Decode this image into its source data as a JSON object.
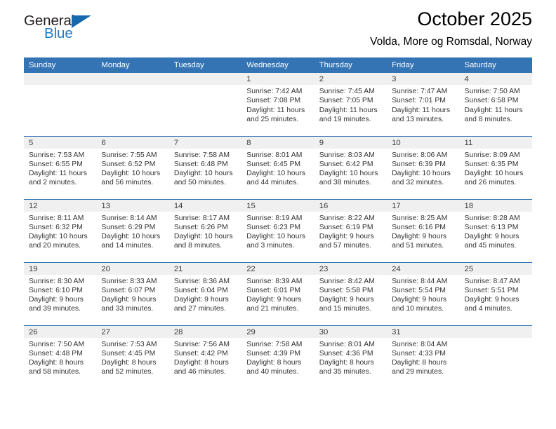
{
  "brand": {
    "name_part1": "General",
    "name_part2": "Blue",
    "triangle_icon": "triangle-icon",
    "color_dark": "#231f20",
    "color_blue": "#1f7ac4"
  },
  "header": {
    "title": "October 2025",
    "subtitle": "Volda, More og Romsdal, Norway",
    "header_bg": "#3474b4",
    "band_bg": "#f0f0f0"
  },
  "weekdays": [
    "Sunday",
    "Monday",
    "Tuesday",
    "Wednesday",
    "Thursday",
    "Friday",
    "Saturday"
  ],
  "labels": {
    "sunrise": "Sunrise:",
    "sunset": "Sunset:",
    "daylight": "Daylight:"
  },
  "weeks": [
    [
      {
        "day": "",
        "empty": true
      },
      {
        "day": "",
        "empty": true
      },
      {
        "day": "",
        "empty": true
      },
      {
        "day": "1",
        "sunrise": "Sunrise: 7:42 AM",
        "sunset": "Sunset: 7:08 PM",
        "daylight1": "Daylight: 11 hours",
        "daylight2": "and 25 minutes."
      },
      {
        "day": "2",
        "sunrise": "Sunrise: 7:45 AM",
        "sunset": "Sunset: 7:05 PM",
        "daylight1": "Daylight: 11 hours",
        "daylight2": "and 19 minutes."
      },
      {
        "day": "3",
        "sunrise": "Sunrise: 7:47 AM",
        "sunset": "Sunset: 7:01 PM",
        "daylight1": "Daylight: 11 hours",
        "daylight2": "and 13 minutes."
      },
      {
        "day": "4",
        "sunrise": "Sunrise: 7:50 AM",
        "sunset": "Sunset: 6:58 PM",
        "daylight1": "Daylight: 11 hours",
        "daylight2": "and 8 minutes."
      }
    ],
    [
      {
        "day": "5",
        "sunrise": "Sunrise: 7:53 AM",
        "sunset": "Sunset: 6:55 PM",
        "daylight1": "Daylight: 11 hours",
        "daylight2": "and 2 minutes."
      },
      {
        "day": "6",
        "sunrise": "Sunrise: 7:55 AM",
        "sunset": "Sunset: 6:52 PM",
        "daylight1": "Daylight: 10 hours",
        "daylight2": "and 56 minutes."
      },
      {
        "day": "7",
        "sunrise": "Sunrise: 7:58 AM",
        "sunset": "Sunset: 6:48 PM",
        "daylight1": "Daylight: 10 hours",
        "daylight2": "and 50 minutes."
      },
      {
        "day": "8",
        "sunrise": "Sunrise: 8:01 AM",
        "sunset": "Sunset: 6:45 PM",
        "daylight1": "Daylight: 10 hours",
        "daylight2": "and 44 minutes."
      },
      {
        "day": "9",
        "sunrise": "Sunrise: 8:03 AM",
        "sunset": "Sunset: 6:42 PM",
        "daylight1": "Daylight: 10 hours",
        "daylight2": "and 38 minutes."
      },
      {
        "day": "10",
        "sunrise": "Sunrise: 8:06 AM",
        "sunset": "Sunset: 6:39 PM",
        "daylight1": "Daylight: 10 hours",
        "daylight2": "and 32 minutes."
      },
      {
        "day": "11",
        "sunrise": "Sunrise: 8:09 AM",
        "sunset": "Sunset: 6:35 PM",
        "daylight1": "Daylight: 10 hours",
        "daylight2": "and 26 minutes."
      }
    ],
    [
      {
        "day": "12",
        "sunrise": "Sunrise: 8:11 AM",
        "sunset": "Sunset: 6:32 PM",
        "daylight1": "Daylight: 10 hours",
        "daylight2": "and 20 minutes."
      },
      {
        "day": "13",
        "sunrise": "Sunrise: 8:14 AM",
        "sunset": "Sunset: 6:29 PM",
        "daylight1": "Daylight: 10 hours",
        "daylight2": "and 14 minutes."
      },
      {
        "day": "14",
        "sunrise": "Sunrise: 8:17 AM",
        "sunset": "Sunset: 6:26 PM",
        "daylight1": "Daylight: 10 hours",
        "daylight2": "and 8 minutes."
      },
      {
        "day": "15",
        "sunrise": "Sunrise: 8:19 AM",
        "sunset": "Sunset: 6:23 PM",
        "daylight1": "Daylight: 10 hours",
        "daylight2": "and 3 minutes."
      },
      {
        "day": "16",
        "sunrise": "Sunrise: 8:22 AM",
        "sunset": "Sunset: 6:19 PM",
        "daylight1": "Daylight: 9 hours",
        "daylight2": "and 57 minutes."
      },
      {
        "day": "17",
        "sunrise": "Sunrise: 8:25 AM",
        "sunset": "Sunset: 6:16 PM",
        "daylight1": "Daylight: 9 hours",
        "daylight2": "and 51 minutes."
      },
      {
        "day": "18",
        "sunrise": "Sunrise: 8:28 AM",
        "sunset": "Sunset: 6:13 PM",
        "daylight1": "Daylight: 9 hours",
        "daylight2": "and 45 minutes."
      }
    ],
    [
      {
        "day": "19",
        "sunrise": "Sunrise: 8:30 AM",
        "sunset": "Sunset: 6:10 PM",
        "daylight1": "Daylight: 9 hours",
        "daylight2": "and 39 minutes."
      },
      {
        "day": "20",
        "sunrise": "Sunrise: 8:33 AM",
        "sunset": "Sunset: 6:07 PM",
        "daylight1": "Daylight: 9 hours",
        "daylight2": "and 33 minutes."
      },
      {
        "day": "21",
        "sunrise": "Sunrise: 8:36 AM",
        "sunset": "Sunset: 6:04 PM",
        "daylight1": "Daylight: 9 hours",
        "daylight2": "and 27 minutes."
      },
      {
        "day": "22",
        "sunrise": "Sunrise: 8:39 AM",
        "sunset": "Sunset: 6:01 PM",
        "daylight1": "Daylight: 9 hours",
        "daylight2": "and 21 minutes."
      },
      {
        "day": "23",
        "sunrise": "Sunrise: 8:42 AM",
        "sunset": "Sunset: 5:58 PM",
        "daylight1": "Daylight: 9 hours",
        "daylight2": "and 15 minutes."
      },
      {
        "day": "24",
        "sunrise": "Sunrise: 8:44 AM",
        "sunset": "Sunset: 5:54 PM",
        "daylight1": "Daylight: 9 hours",
        "daylight2": "and 10 minutes."
      },
      {
        "day": "25",
        "sunrise": "Sunrise: 8:47 AM",
        "sunset": "Sunset: 5:51 PM",
        "daylight1": "Daylight: 9 hours",
        "daylight2": "and 4 minutes."
      }
    ],
    [
      {
        "day": "26",
        "sunrise": "Sunrise: 7:50 AM",
        "sunset": "Sunset: 4:48 PM",
        "daylight1": "Daylight: 8 hours",
        "daylight2": "and 58 minutes."
      },
      {
        "day": "27",
        "sunrise": "Sunrise: 7:53 AM",
        "sunset": "Sunset: 4:45 PM",
        "daylight1": "Daylight: 8 hours",
        "daylight2": "and 52 minutes."
      },
      {
        "day": "28",
        "sunrise": "Sunrise: 7:56 AM",
        "sunset": "Sunset: 4:42 PM",
        "daylight1": "Daylight: 8 hours",
        "daylight2": "and 46 minutes."
      },
      {
        "day": "29",
        "sunrise": "Sunrise: 7:58 AM",
        "sunset": "Sunset: 4:39 PM",
        "daylight1": "Daylight: 8 hours",
        "daylight2": "and 40 minutes."
      },
      {
        "day": "30",
        "sunrise": "Sunrise: 8:01 AM",
        "sunset": "Sunset: 4:36 PM",
        "daylight1": "Daylight: 8 hours",
        "daylight2": "and 35 minutes."
      },
      {
        "day": "31",
        "sunrise": "Sunrise: 8:04 AM",
        "sunset": "Sunset: 4:33 PM",
        "daylight1": "Daylight: 8 hours",
        "daylight2": "and 29 minutes."
      },
      {
        "day": "",
        "empty": true
      }
    ]
  ]
}
